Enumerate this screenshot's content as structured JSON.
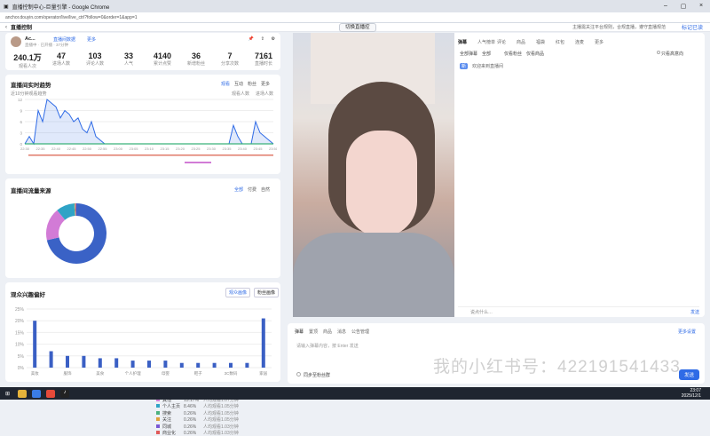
{
  "window": {
    "title": "直播控制中心-巨量引擎 - Google Chrome",
    "url": "anchor.douyin.com/operator/live/live_ctrl?follow=0&order=1&app=1"
  },
  "header": {
    "back": "‹",
    "title": "直播控制",
    "center_button": "切换直播控",
    "notice": "主播需关注平台规则，合规直播，遵守直播规范",
    "lock_label": "标记已读"
  },
  "anchor": {
    "name": "Ac...",
    "tag1": "直播间数据",
    "tag2": "更多",
    "line2": "直播中 · 已开播 · 37分钟"
  },
  "stats": [
    {
      "value": "240.1万",
      "label": "观看人次"
    },
    {
      "value": "47",
      "label": "进场人数"
    },
    {
      "value": "103",
      "label": "评论人数"
    },
    {
      "value": "33",
      "label": "人气"
    },
    {
      "value": "4140",
      "label": "累计点赞"
    },
    {
      "value": "36",
      "label": "新增粉丝"
    },
    {
      "value": "7",
      "label": "分享次数"
    },
    {
      "value": "7161",
      "label": "直播时长"
    }
  ],
  "trend": {
    "title": "直播间实时趋势",
    "tabs": [
      "观看",
      "互动",
      "粉丝",
      "更多"
    ],
    "legend": [
      "观看人数",
      "进场人数"
    ],
    "sub": "近10分钟观看趋势"
  },
  "source": {
    "title": "直播间流量来源",
    "tabs": [
      "全部",
      "付费",
      "自然"
    ],
    "rows": [
      {
        "name": "直播推荐",
        "pct": "61.78%",
        "detail": "人均观看1.07分钟"
      },
      {
        "name": "其他",
        "pct": "15.17%",
        "detail": "人均观看1.07分钟"
      },
      {
        "name": "个人主页",
        "pct": "8.46%",
        "detail": "人均观看1.05分钟"
      },
      {
        "name": "搜索",
        "pct": "0.26%",
        "detail": "人均观看1.05分钟"
      },
      {
        "name": "关注",
        "pct": "0.26%",
        "detail": "人均观看1.05分钟"
      },
      {
        "name": "同城",
        "pct": "0.26%",
        "detail": "人均观看1.03分钟"
      },
      {
        "name": "商业化",
        "pct": "0.26%",
        "detail": "人均观看1.03分钟"
      }
    ]
  },
  "interest": {
    "title": "观众兴趣偏好",
    "btn1": "观众画像",
    "btn2": "粉丝画像"
  },
  "chart_data": [
    {
      "type": "pie",
      "values": [
        61.78,
        15.17,
        8.46,
        0.26,
        0.26,
        0.26,
        0.26
      ],
      "categories": [
        "直播推荐",
        "其他",
        "个人主页",
        "搜索",
        "关注",
        "同城",
        "商业化"
      ]
    },
    {
      "type": "bar",
      "categories": [
        "美妆",
        "",
        "服饰",
        "",
        "美食",
        "",
        "个人护理",
        "",
        "母婴",
        "",
        "鞋子",
        "",
        "3C数码",
        "",
        "家居"
      ],
      "values": [
        20,
        7,
        5,
        5,
        4,
        4,
        3,
        3,
        3,
        2,
        2,
        2,
        2,
        2,
        21
      ],
      "ylim": [
        0,
        25
      ],
      "yticks": [
        "0%",
        "5%",
        "10%",
        "15%",
        "20%",
        "25%"
      ]
    },
    {
      "type": "line",
      "series": [
        {
          "name": "观看人数",
          "values": [
            0,
            2,
            0,
            9,
            6,
            12,
            11,
            10,
            7,
            9,
            8,
            6,
            7,
            4,
            3,
            6,
            2,
            1,
            0,
            0,
            0,
            0,
            0,
            0,
            0,
            0,
            0,
            0,
            0,
            0,
            0,
            0,
            0,
            0,
            0,
            0,
            0,
            0,
            0,
            0,
            0,
            0,
            0,
            0,
            0,
            0,
            0,
            5,
            2,
            0,
            0,
            0,
            6,
            3,
            2,
            1,
            0
          ]
        }
      ],
      "x": [
        "22:30",
        "22:35",
        "22:40",
        "22:45",
        "22:50",
        "22:55",
        "23:00",
        "23:05",
        "23:10",
        "23:15",
        "23:20",
        "23:25",
        "23:30",
        "23:35",
        "23:40",
        "23:45",
        "23:50"
      ]
    }
  ],
  "right": {
    "tabs": [
      "弹幕",
      "人气榜单",
      "评论",
      "商品",
      "福袋",
      "红包",
      "连麦",
      "更多"
    ],
    "filters": [
      "全部弹幕",
      "全部",
      "仅看粉丝",
      "仅看商品"
    ],
    "toggle": "只看高意向",
    "first_msg": "欢迎来到直播间",
    "bottom_input_ph": "说点什么…",
    "send": "发送"
  },
  "compose": {
    "tabs": [
      "弹幕",
      "置顶",
      "商品",
      "消息",
      "公告管理"
    ],
    "placeholder": "请输入弹幕内容，按 Enter 发送",
    "footer_check": "同步至粉丝群",
    "send_btn": "发送",
    "side_link": "更多设置"
  },
  "watermark": "我的小红书号：422191541433",
  "taskbar": {
    "time": "23:07",
    "date": "2025/12/1"
  }
}
